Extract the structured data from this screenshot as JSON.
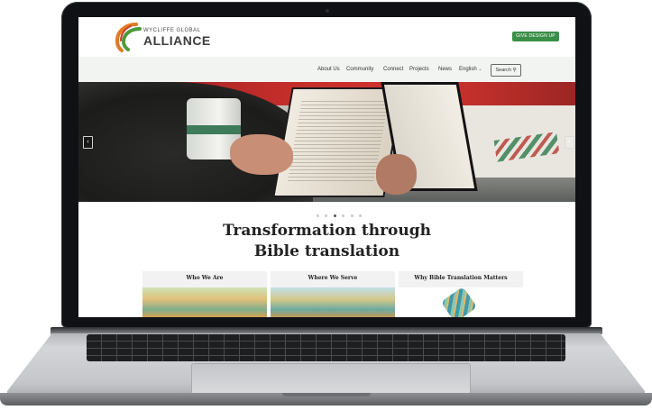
{
  "header": {
    "brand_small": "WYCLIFFE GLOBAL",
    "brand_big": "ALLIANCE",
    "give_label": "GIVE DESIGN UP"
  },
  "nav": {
    "items": [
      "About Us",
      "Community",
      "Connect",
      "Projects",
      "News"
    ],
    "language": "English",
    "search_label": "Search"
  },
  "hero": {
    "prev_icon": "‹",
    "next_icon": "›",
    "slide_count": 6,
    "active_slide": 3
  },
  "headline": {
    "line1": "Transformation through",
    "line2": "Bible translation"
  },
  "cards": [
    {
      "title": "Who We Are"
    },
    {
      "title": "Where We Serve"
    },
    {
      "title": "Why Bible Translation Matters"
    }
  ],
  "colors": {
    "brand_green": "#3a8f47",
    "logo_orange": "#e07a23",
    "logo_green": "#4f9a3a",
    "hero_red": "#c22d2a"
  }
}
